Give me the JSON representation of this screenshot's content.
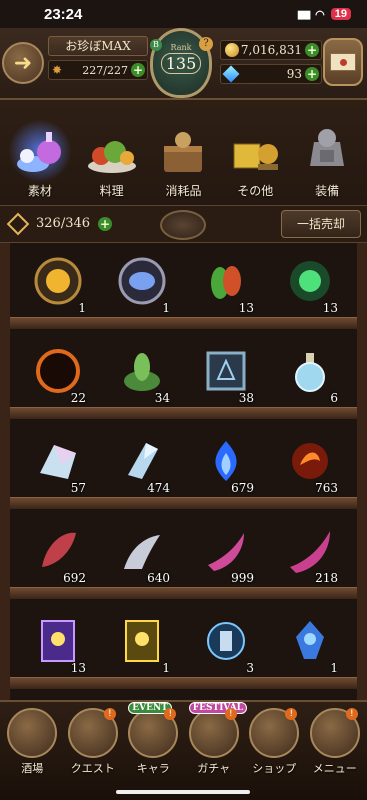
{
  "status": {
    "time": "23:24",
    "signal": "∣∣∣",
    "wifi": "◔",
    "battery": "19"
  },
  "header": {
    "player_name": "お珍ぼMAX",
    "stamina": "227/227",
    "rank_label": "Rank",
    "rank_value": "135",
    "gold": "7,016,831",
    "gems": "93"
  },
  "categories": [
    {
      "key": "materials",
      "label": "素材",
      "active": true
    },
    {
      "key": "cooking",
      "label": "料理",
      "active": false
    },
    {
      "key": "consumables",
      "label": "消耗品",
      "active": false
    },
    {
      "key": "other",
      "label": "その他",
      "active": false
    },
    {
      "key": "equipment",
      "label": "装備",
      "active": false
    }
  ],
  "inventory": {
    "count": "326/346",
    "sell_all_label": "一括売却"
  },
  "shelves": [
    [
      {
        "icon": "gold-emblem-icon",
        "qty": "1"
      },
      {
        "icon": "silver-emblem-icon",
        "qty": "1"
      },
      {
        "icon": "red-green-leaf-icon",
        "qty": "13"
      },
      {
        "icon": "green-gem-icon",
        "qty": "13"
      }
    ],
    [
      {
        "icon": "dark-ring-icon",
        "qty": "22"
      },
      {
        "icon": "herb-bush-icon",
        "qty": "34"
      },
      {
        "icon": "rune-tablet-icon",
        "qty": "38"
      },
      {
        "icon": "potion-bottle-icon",
        "qty": "6"
      }
    ],
    [
      {
        "icon": "crystal-cluster-icon",
        "qty": "57"
      },
      {
        "icon": "blue-crystal-icon",
        "qty": "474"
      },
      {
        "icon": "blue-flame-icon",
        "qty": "679"
      },
      {
        "icon": "fire-orb-icon",
        "qty": "763"
      }
    ],
    [
      {
        "icon": "red-feather-icon",
        "qty": "692"
      },
      {
        "icon": "silver-claw-icon",
        "qty": "640"
      },
      {
        "icon": "pink-horn-icon",
        "qty": "999"
      },
      {
        "icon": "pink-horn-large-icon",
        "qty": "218"
      }
    ],
    [
      {
        "icon": "purple-card-icon",
        "qty": "13",
        "stars": "★★★★★"
      },
      {
        "icon": "gold-card-icon",
        "qty": "1",
        "stars": "★★★★★"
      },
      {
        "icon": "blue-relic-icon",
        "qty": "3",
        "stars": "★★★★"
      },
      {
        "icon": "blue-spirit-icon",
        "qty": "1",
        "stars": "★★★★★"
      }
    ]
  ],
  "nav": [
    {
      "key": "tavern",
      "label": "酒場",
      "badge": ""
    },
    {
      "key": "quest",
      "label": "クエスト",
      "badge": ""
    },
    {
      "key": "chara",
      "label": "キャラ",
      "badge": "EVENT"
    },
    {
      "key": "gacha",
      "label": "ガチャ",
      "badge": "FESTIVAL"
    },
    {
      "key": "shop",
      "label": "ショップ",
      "badge": ""
    },
    {
      "key": "menu",
      "label": "メニュー",
      "badge": ""
    }
  ],
  "colors": {
    "accent_gold": "#e3b45a",
    "plus_green": "#3d8c2c",
    "active_glow": "#5a82ff"
  }
}
